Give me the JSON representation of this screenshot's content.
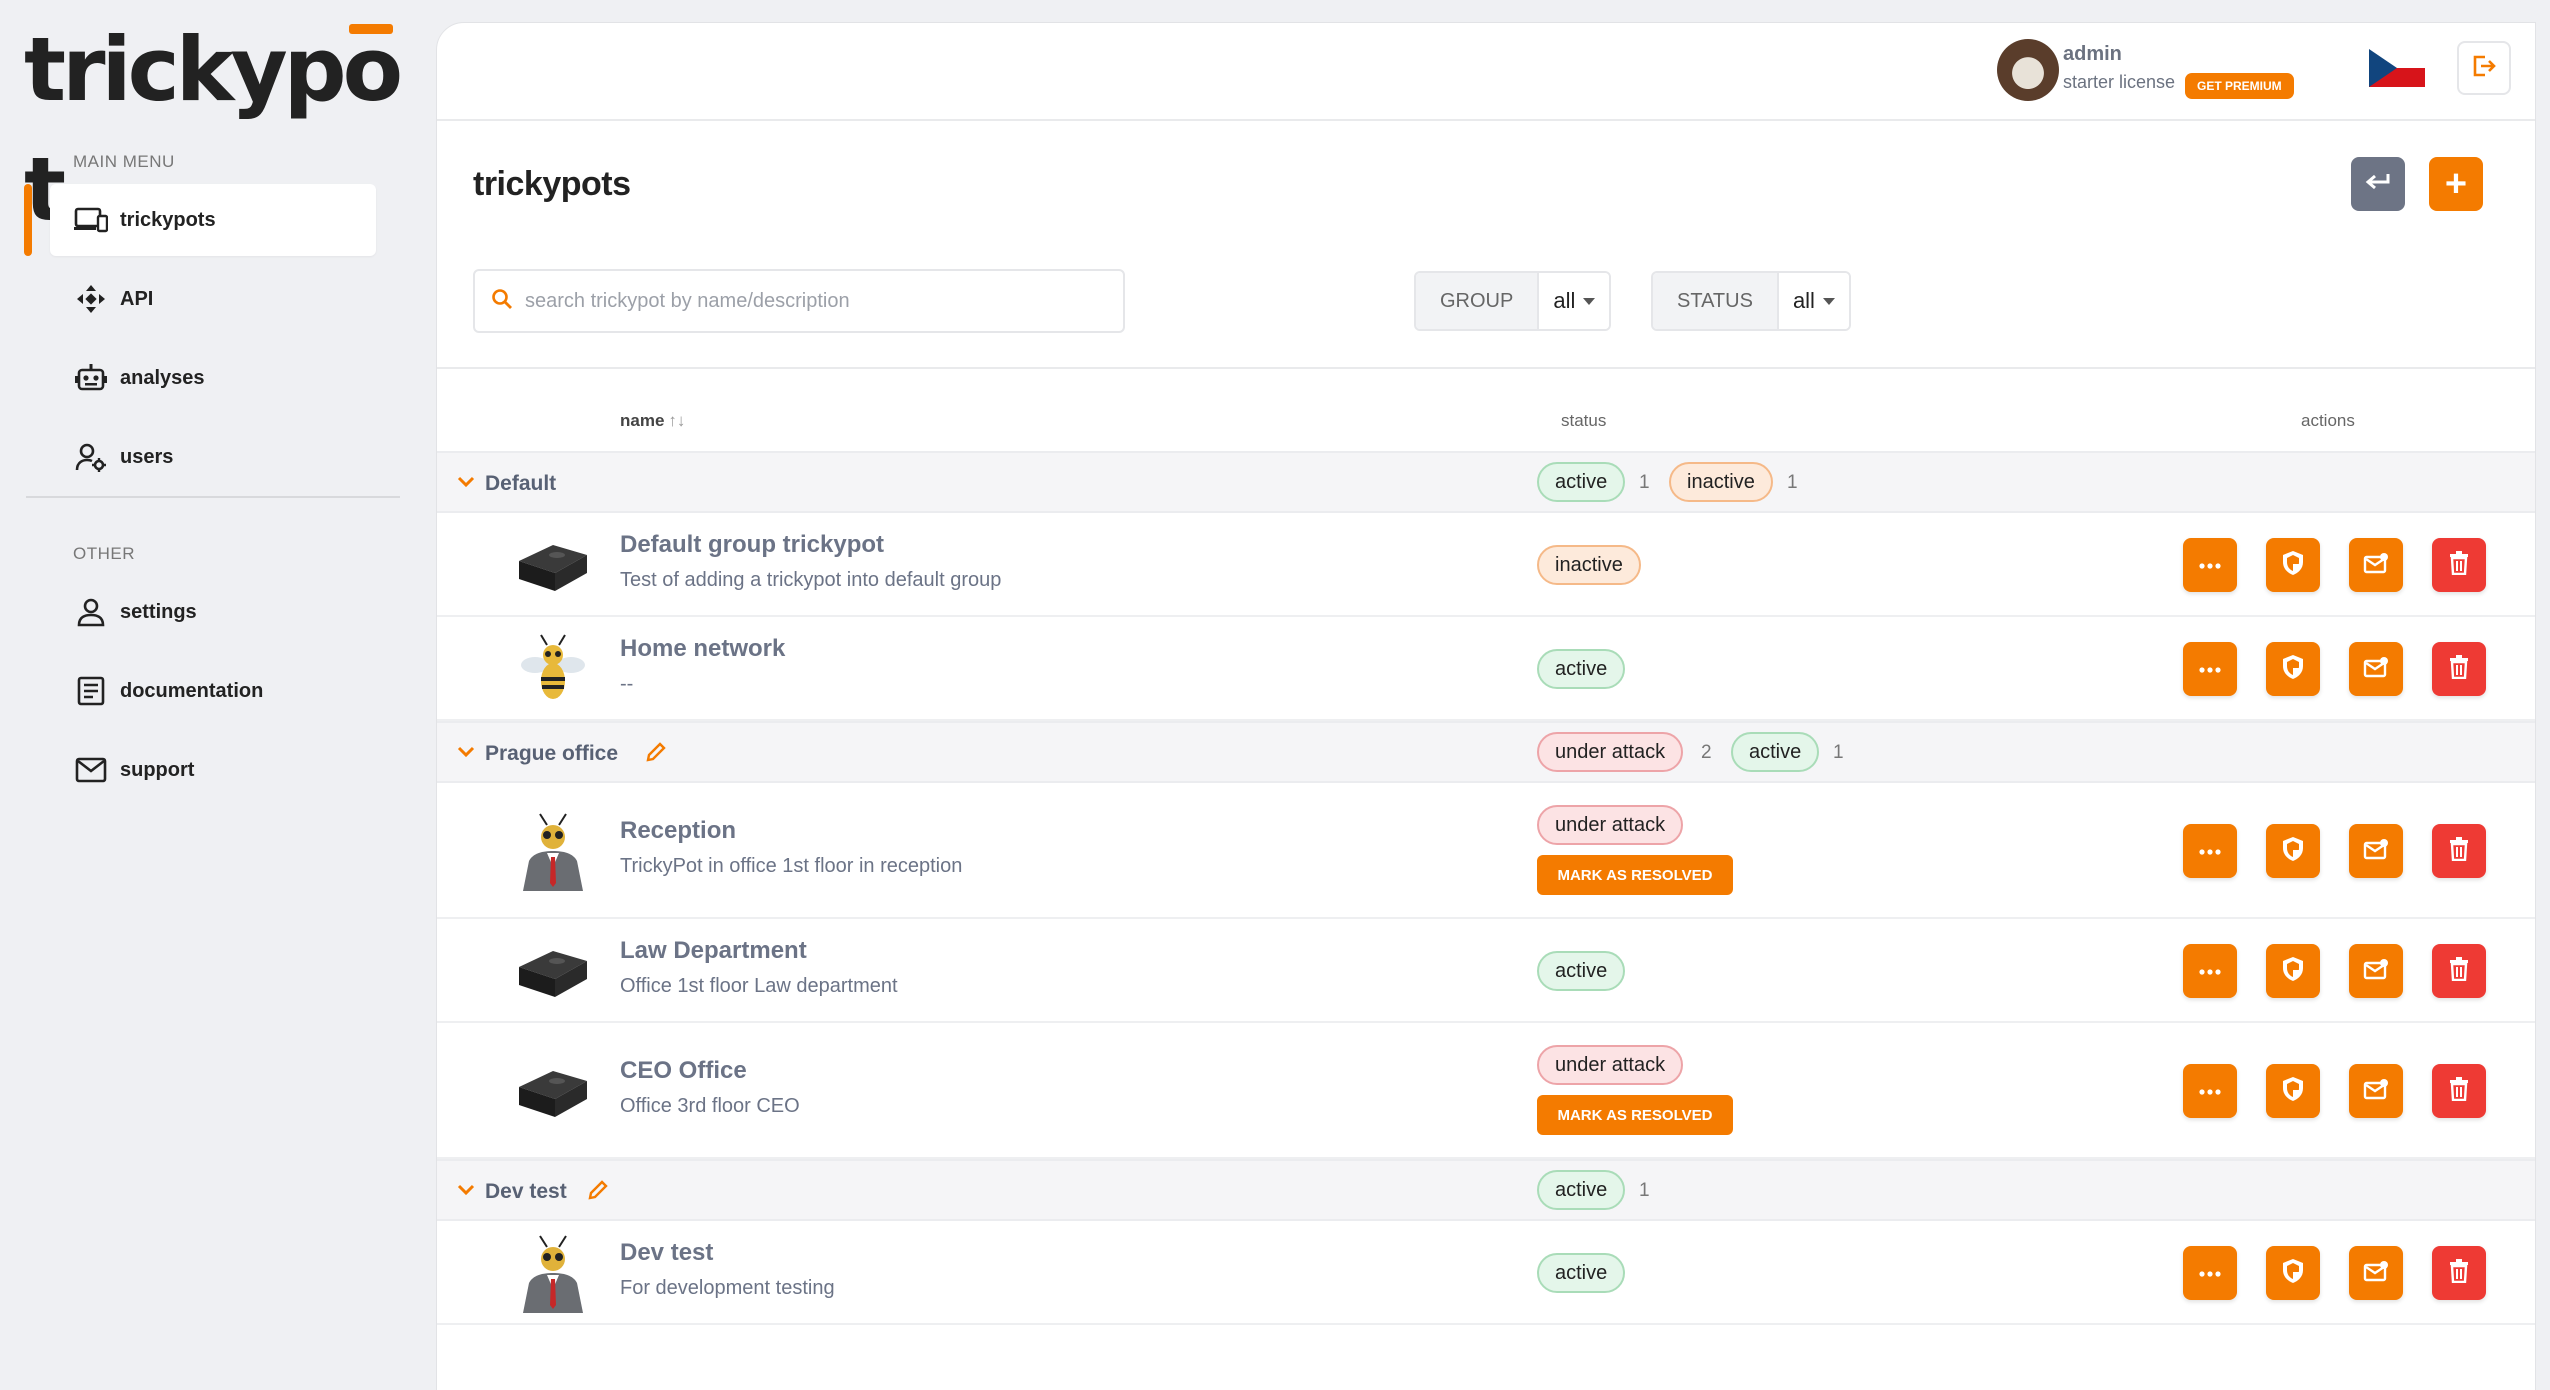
{
  "brand": {
    "logo_text_pre": "trickyp",
    "logo_text_o": "o",
    "logo_text_post": "t"
  },
  "colors": {
    "accent": "#f47b00",
    "danger": "#ee3a34",
    "active_green": "#a9dcb8",
    "inactive_orange": "#f5b988",
    "attack_red": "#eda4a8"
  },
  "sidebar": {
    "main_menu_label": "MAIN MENU",
    "other_label": "OTHER",
    "main_items": [
      {
        "label": "trickypots",
        "icon": "devices-icon"
      },
      {
        "label": "API",
        "icon": "api-icon"
      },
      {
        "label": "analyses",
        "icon": "robot-icon"
      },
      {
        "label": "users",
        "icon": "users-gear-icon"
      }
    ],
    "other_items": [
      {
        "label": "settings",
        "icon": "person-icon"
      },
      {
        "label": "documentation",
        "icon": "document-icon"
      },
      {
        "label": "support",
        "icon": "mail-icon"
      }
    ]
  },
  "header": {
    "user_name": "admin",
    "license": "starter license",
    "premium_label": "GET PREMIUM",
    "language_flag": "czech-flag-icon",
    "logout_icon": "logout-icon"
  },
  "page": {
    "title": "trickypots",
    "back_icon": "return-icon",
    "add_label": "+"
  },
  "filters": {
    "search_placeholder": "search trickypot by name/description",
    "group_label": "GROUP",
    "group_value": "all",
    "status_label": "STATUS",
    "status_value": "all"
  },
  "table": {
    "col_name": "name",
    "col_sort": "↑↓",
    "col_status": "status",
    "col_actions": "actions",
    "groups": [
      {
        "name": "Default",
        "editable": false,
        "summary": [
          {
            "status": "active",
            "count": "1"
          },
          {
            "status": "inactive",
            "count": "1"
          }
        ],
        "items": [
          {
            "name": "Default group trickypot",
            "desc": "Test of adding a trickypot into default group",
            "status": "inactive",
            "image": "box-device-icon",
            "resolve": ""
          },
          {
            "name": "Home network",
            "desc": "--",
            "status": "active",
            "image": "bee-avatar-icon",
            "resolve": ""
          }
        ]
      },
      {
        "name": "Prague office",
        "editable": true,
        "summary": [
          {
            "status": "under attack",
            "count": "2"
          },
          {
            "status": "active",
            "count": "1"
          }
        ],
        "items": [
          {
            "name": "Reception",
            "desc": "TrickyPot in office 1st floor in reception",
            "status": "under attack",
            "image": "bee-suit-avatar-icon",
            "resolve": "MARK AS RESOLVED"
          },
          {
            "name": "Law Department",
            "desc": "Office 1st floor Law department",
            "status": "active",
            "image": "box-device-icon",
            "resolve": ""
          },
          {
            "name": "CEO Office",
            "desc": "Office 3rd floor CEO",
            "status": "under attack",
            "image": "box-device-icon",
            "resolve": "MARK AS RESOLVED"
          }
        ]
      },
      {
        "name": "Dev test",
        "editable": true,
        "summary": [
          {
            "status": "active",
            "count": "1"
          }
        ],
        "items": [
          {
            "name": "Dev test",
            "desc": "For development testing",
            "status": "active",
            "image": "bee-suit-avatar-icon",
            "resolve": ""
          }
        ]
      }
    ],
    "row_actions": [
      "more-icon",
      "shield-icon",
      "mail-alert-icon",
      "trash-icon"
    ]
  }
}
